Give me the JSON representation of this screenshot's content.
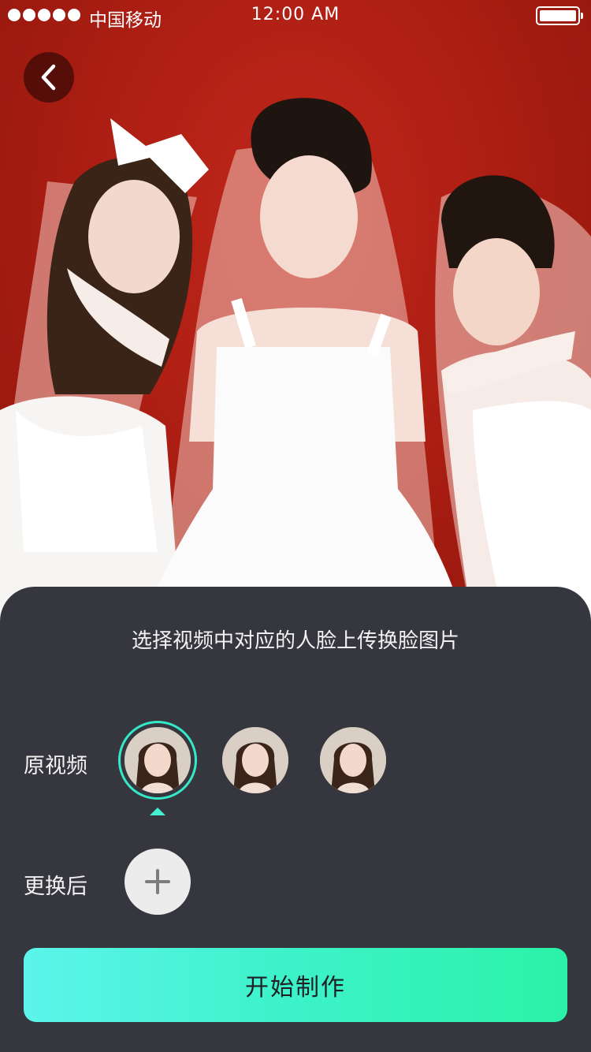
{
  "status_bar": {
    "carrier": "中国移动",
    "time": "12:00 AM"
  },
  "sheet": {
    "title": "选择视频中对应的人脸上传换脸图片",
    "original_label": "原视频",
    "replaced_label": "更换后",
    "start_button": "开始制作"
  },
  "colors": {
    "accent": "#34e9c8",
    "background_red": "#a91d12",
    "sheet": "#36363e",
    "button_gradient_start": "#5cf4ec",
    "button_gradient_end": "#2cf2a8"
  },
  "icons": {
    "back": "chevron-left-icon",
    "add": "plus-icon"
  }
}
